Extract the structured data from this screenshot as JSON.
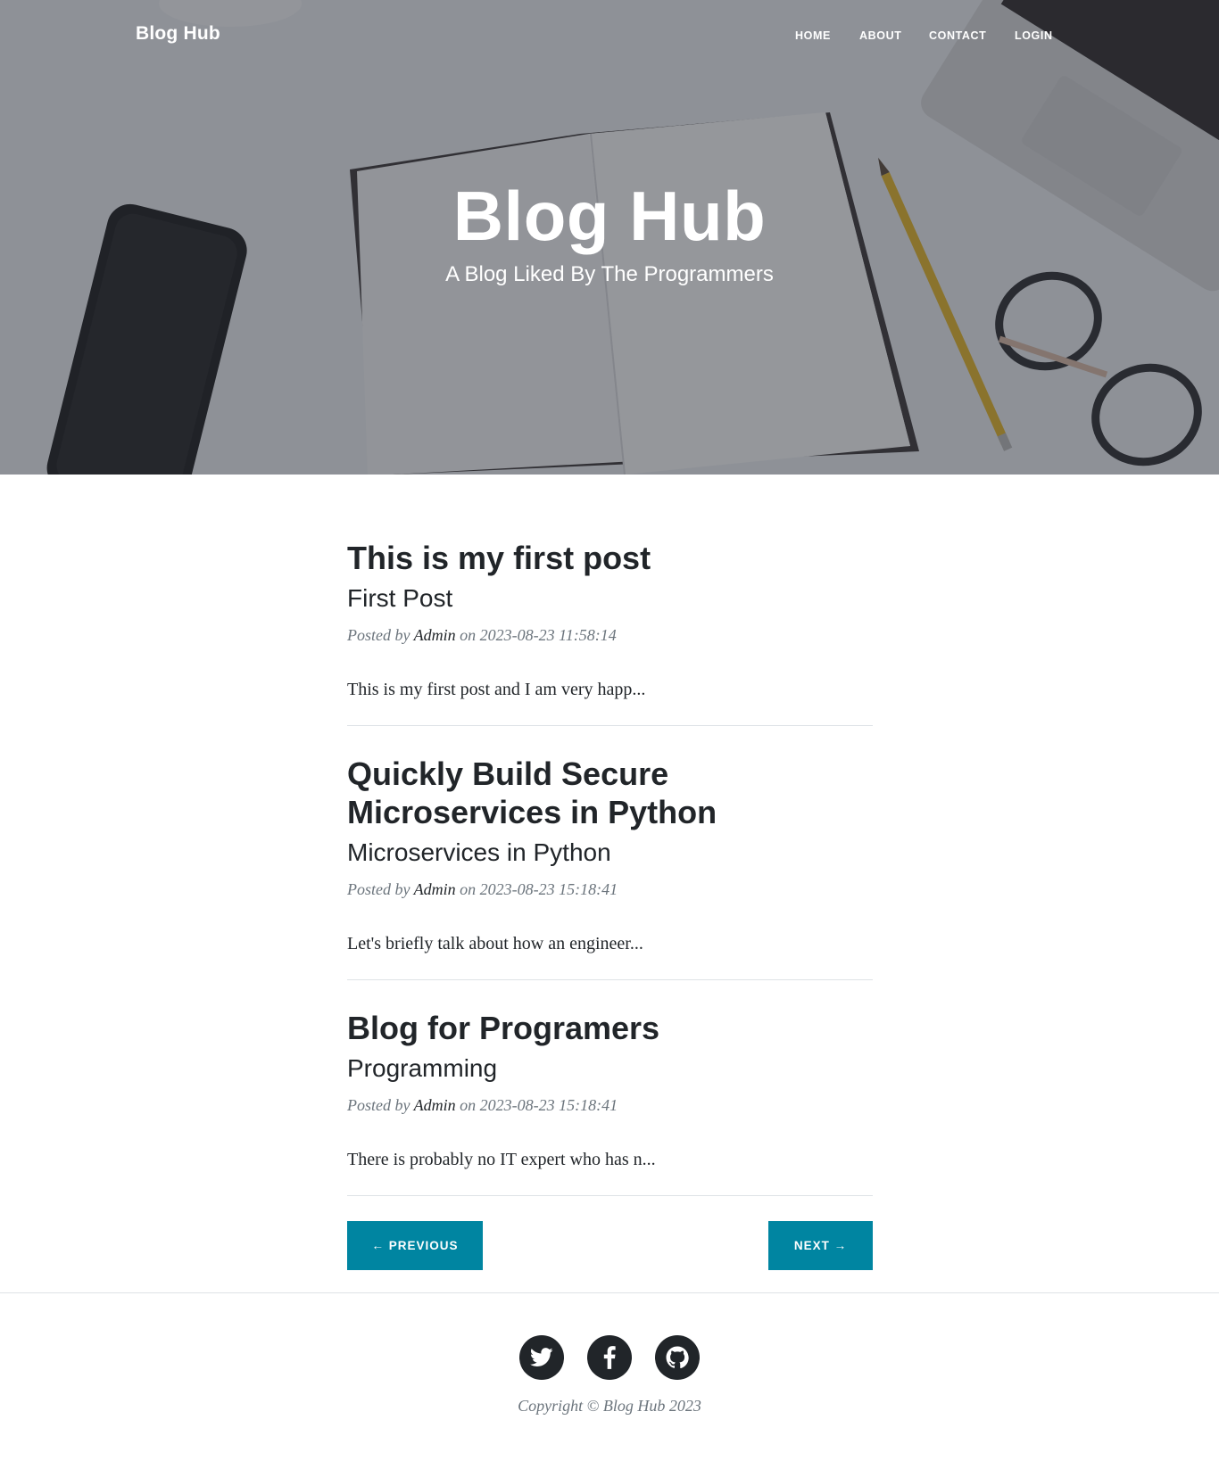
{
  "navbar": {
    "brand": "Blog Hub",
    "links": [
      "Home",
      "About",
      "Contact",
      "Login"
    ]
  },
  "hero": {
    "title": "Blog Hub",
    "subtitle": "A Blog Liked By The Programmers"
  },
  "posts": [
    {
      "title": "This is my first post",
      "subtitle": "First Post",
      "meta_prefix": "Posted by ",
      "author": "Admin",
      "meta_on": " on ",
      "date": "2023-08-23 11:58:14",
      "excerpt": "This is my first post and I am very happ..."
    },
    {
      "title": "Quickly Build Secure Microservices in Python",
      "subtitle": "Microservices in Python",
      "meta_prefix": "Posted by ",
      "author": "Admin",
      "meta_on": " on ",
      "date": "2023-08-23 15:18:41",
      "excerpt": "Let's briefly talk about how an engineer..."
    },
    {
      "title": "Blog for Programers",
      "subtitle": "Programming",
      "meta_prefix": "Posted by ",
      "author": "Admin",
      "meta_on": " on ",
      "date": "2023-08-23 15:18:41",
      "excerpt": "There is probably no IT expert who has n..."
    }
  ],
  "pager": {
    "previous": "← Previous",
    "next": "Next →"
  },
  "footer": {
    "social_icons": [
      "twitter-icon",
      "facebook-icon",
      "github-icon"
    ],
    "copyright": "Copyright © Blog Hub 2023"
  },
  "colors": {
    "accent": "#0085a1",
    "text": "#212529",
    "muted": "#6c757d"
  }
}
